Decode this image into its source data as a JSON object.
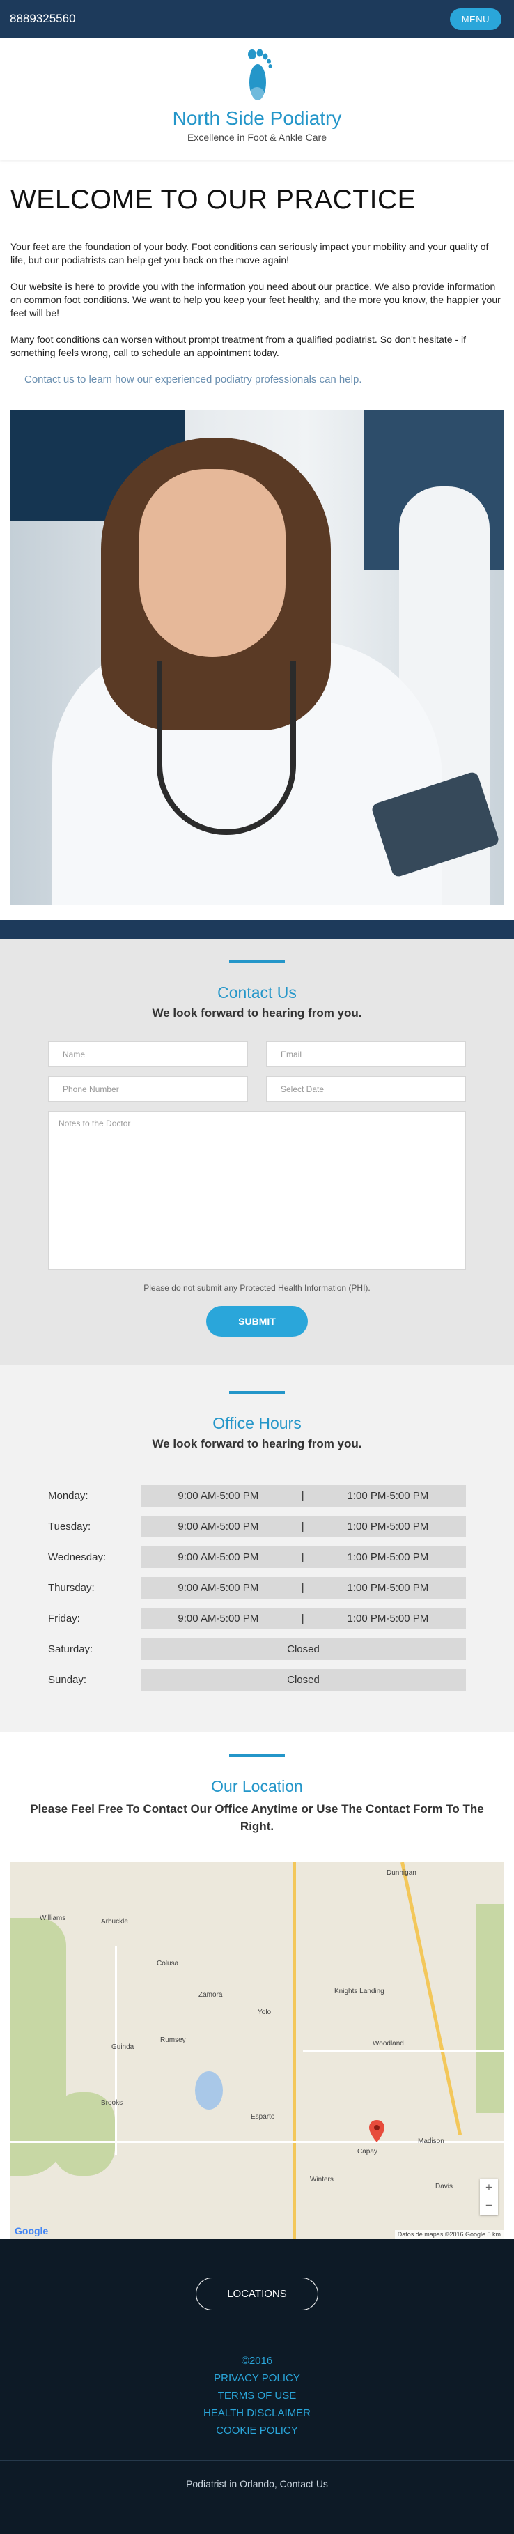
{
  "topbar": {
    "phone": "8889325560",
    "menu_label": "MENU"
  },
  "header": {
    "brand": "North Side Podiatry",
    "tagline": "Excellence in Foot & Ankle Care",
    "logo_icon": "foot-icon",
    "brand_color": "#2496c9"
  },
  "welcome": {
    "title": "WELCOME TO OUR PRACTICE",
    "paragraphs": [
      "Your feet are the foundation of your body. Foot conditions can seriously impact your mobility and your quality of life, but our podiatrists can help get you back on the move again!",
      "Our website is here to provide you with the information you need about our practice. We also provide information on common foot conditions. We want to help you keep your feet healthy, and the more you know, the happier your feet will be!",
      "Many foot conditions can worsen without prompt treatment from a qualified podiatrist. So don't hesitate - if something feels wrong, call to schedule an appointment today."
    ],
    "contact_cta": "Contact us to learn how our experienced podiatry professionals can help."
  },
  "contact": {
    "title": "Contact Us",
    "subtitle": "We look forward to hearing from you.",
    "name_placeholder": "Name",
    "email_placeholder": "Email",
    "phone_placeholder": "Phone Number",
    "date_placeholder": "Select Date",
    "notes_placeholder": "Notes to the Doctor",
    "disclaimer": "Please do not submit any Protected Health Information (PHI).",
    "submit_label": "SUBMIT"
  },
  "hours": {
    "title": "Office Hours",
    "subtitle": "We look forward to hearing from you.",
    "days": [
      {
        "day": "Monday:",
        "am": "9:00 AM-5:00 PM",
        "sep": "|",
        "pm": "1:00 PM-5:00 PM"
      },
      {
        "day": "Tuesday:",
        "am": "9:00 AM-5:00 PM",
        "sep": "|",
        "pm": "1:00 PM-5:00 PM"
      },
      {
        "day": "Wednesday:",
        "am": "9:00 AM-5:00 PM",
        "sep": "|",
        "pm": "1:00 PM-5:00 PM"
      },
      {
        "day": "Thursday:",
        "am": "9:00 AM-5:00 PM",
        "sep": "|",
        "pm": "1:00 PM-5:00 PM"
      },
      {
        "day": "Friday:",
        "am": "9:00 AM-5:00 PM",
        "sep": "|",
        "pm": "1:00 PM-5:00 PM"
      }
    ],
    "closed_days": [
      {
        "day": "Saturday:",
        "status": "Closed"
      },
      {
        "day": "Sunday:",
        "status": "Closed"
      }
    ]
  },
  "location": {
    "title": "Our Location",
    "subtitle": "Please Feel Free To Contact Our Office Anytime or Use The Contact Form To The Right.",
    "map_labels": {
      "dunnigan": "Dunnigan",
      "williams": "Williams",
      "arbuckle": "Arbuckle",
      "colusa": "Colusa",
      "woodland": "Woodland",
      "davis": "Davis",
      "winters": "Winters",
      "esparto": "Esparto",
      "capay": "Capay",
      "madison": "Madison",
      "yolo": "Yolo",
      "zamora": "Zamora",
      "guinda": "Guinda",
      "brooks": "Brooks",
      "rumsey": "Rumsey",
      "knights_landing": "Knights Landing"
    },
    "map_credits": "Datos de mapas ©2016 Google   5 km",
    "google_label": "Google",
    "zoom_in": "+",
    "zoom_out": "−"
  },
  "footer": {
    "notice": "",
    "locations_label": "LOCATIONS",
    "copyright": "©2016",
    "links": [
      "PRIVACY POLICY",
      "TERMS OF USE",
      "HEALTH DISCLAIMER",
      "COOKIE POLICY"
    ],
    "bottom_text": "Podiatrist in Orlando, Contact Us"
  }
}
